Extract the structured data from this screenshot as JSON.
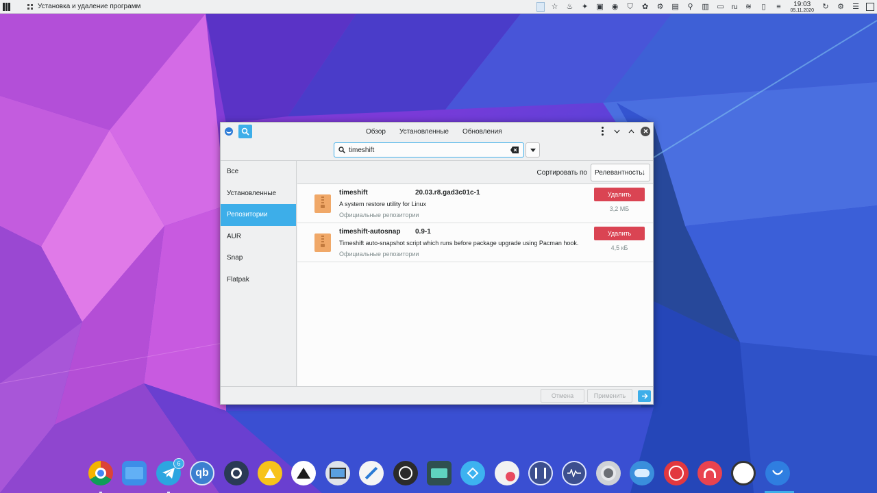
{
  "top_panel": {
    "window_title": "Установка и удаление программ",
    "keyboard_layout": "ru",
    "clock_time": "19:03",
    "clock_date": "05.11.2020",
    "tray_icons": [
      "clipboard-icon",
      "star-icon",
      "bell-icon",
      "puzzle-icon",
      "notes-icon",
      "record-icon",
      "shield-icon",
      "hamster-icon",
      "updates-icon",
      "telegram-tray-icon",
      "location-icon",
      "network-folder-icon",
      "display-icon",
      "wifi-icon",
      "battery-icon",
      "power-icon",
      "settings-icon",
      "menu-icon"
    ]
  },
  "window": {
    "tabs": [
      "Обзор",
      "Установленные",
      "Обновления"
    ],
    "search": {
      "value": "timeshift",
      "placeholder": ""
    },
    "sidebar": {
      "items": [
        {
          "label": "Все",
          "active": false
        },
        {
          "label": "Установленные",
          "active": false
        },
        {
          "label": "Репозитории",
          "active": true
        },
        {
          "label": "AUR",
          "active": false
        },
        {
          "label": "Snap",
          "active": false
        },
        {
          "label": "Flatpak",
          "active": false
        }
      ]
    },
    "sort": {
      "label": "Сортировать по",
      "value": "Релевантность"
    },
    "packages": [
      {
        "name": "timeshift",
        "version": "20.03.r8.gad3c01c-1",
        "description": "A system restore utility for Linux",
        "repo": "Официальные репозитории",
        "action": "Удалить",
        "size": "3,2 МБ"
      },
      {
        "name": "timeshift-autosnap",
        "version": "0.9-1",
        "description": "Timeshift auto-snapshot script which runs before package upgrade using Pacman hook.",
        "repo": "Официальные репозитории",
        "action": "Удалить",
        "size": "4,5 кБ"
      }
    ],
    "footer": {
      "cancel": "Отмена",
      "apply": "Применить"
    }
  },
  "dock": {
    "telegram_badge": "6",
    "apps": [
      "chrome-icon",
      "files-icon",
      "telegram-icon",
      "qbittorrent-icon",
      "steam-icon",
      "vlc-like-icon",
      "inkscape-icon",
      "virt-manager-icon",
      "krita-icon",
      "obs-icon",
      "cassette-icon",
      "kdeconnect-icon",
      "calculator-icon",
      "mixer-icon",
      "audio-wave-icon",
      "disk-usage-icon",
      "toggle-settings-icon",
      "timeshift-clock-icon",
      "headphones-icon",
      "circle-app-icon",
      "pamac-icon"
    ]
  },
  "colors": {
    "accent": "#3daee9",
    "danger": "#da4453",
    "window_bg": "#eff0f1",
    "panel_bg": "#eff0f1"
  }
}
